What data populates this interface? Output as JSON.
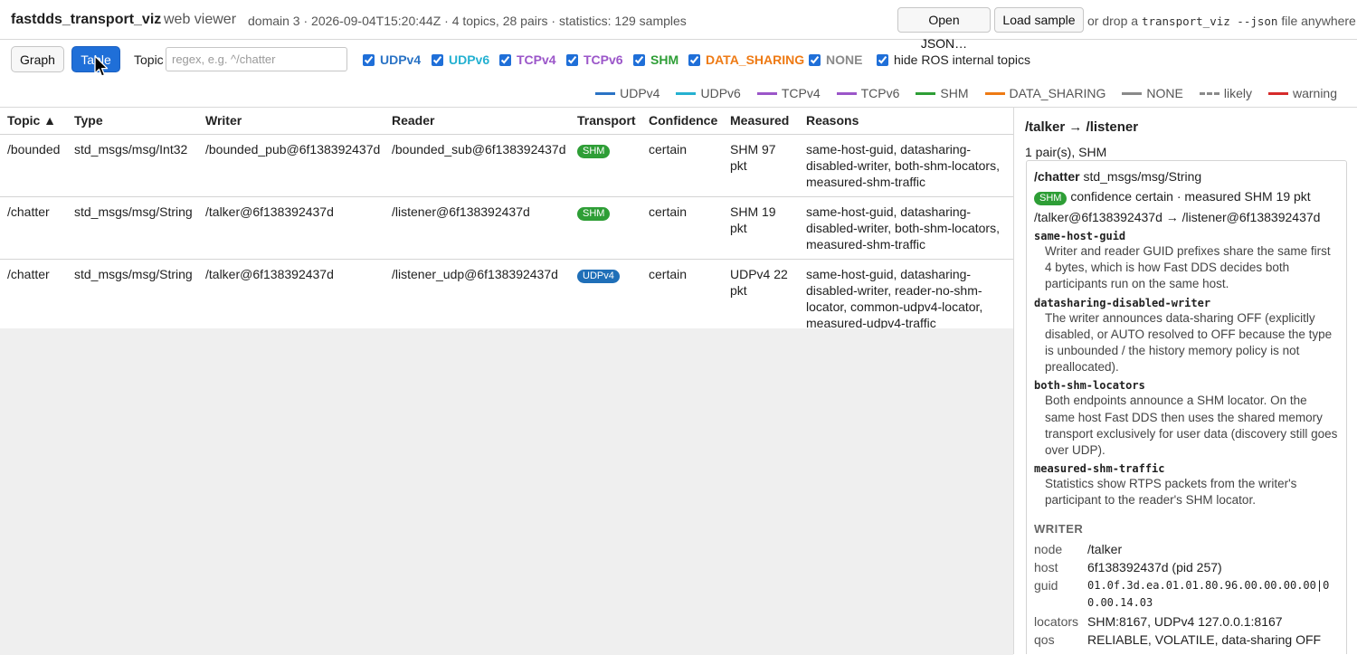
{
  "header": {
    "app_name": "fastdds_transport_viz",
    "subtitle": "web viewer",
    "summary": "domain 3 · 2026-09-04T15:20:44Z · 4 topics, 28 pairs · statistics: 129 samples",
    "open_json_label": "Open JSON…",
    "load_sample_label": "Load sample",
    "drop_hint_prefix": "or drop a",
    "drop_hint_code": "transport_viz --json",
    "drop_hint_suffix": "file anywhere"
  },
  "toolbar": {
    "graph_label": "Graph",
    "table_label": "Table",
    "active_view": "Table",
    "topic_label": "Topic",
    "topic_placeholder": "regex, e.g. ^/chatter",
    "topic_value": "",
    "transport_filters": [
      {
        "label": "UDPv4",
        "checked": true,
        "color": "#2a73c5"
      },
      {
        "label": "UDPv6",
        "checked": true,
        "color": "#25b1d1"
      },
      {
        "label": "TCPv4",
        "checked": true,
        "color": "#9b56c9"
      },
      {
        "label": "TCPv6",
        "checked": true,
        "color": "#9b56c9"
      },
      {
        "label": "SHM",
        "checked": true,
        "color": "#2e9e36"
      },
      {
        "label": "DATA_SHARING",
        "checked": true,
        "color": "#ee7a14"
      },
      {
        "label": "NONE",
        "checked": true,
        "color": "#8a8a8a"
      }
    ],
    "hide_ros_label": "hide ROS internal topics",
    "hide_ros_checked": true
  },
  "legend": [
    {
      "label": "UDPv4",
      "color": "#2a73c5",
      "style": "solid"
    },
    {
      "label": "UDPv6",
      "color": "#25b1d1",
      "style": "solid"
    },
    {
      "label": "TCPv4",
      "color": "#9b56c9",
      "style": "solid"
    },
    {
      "label": "TCPv6",
      "color": "#9b56c9",
      "style": "solid"
    },
    {
      "label": "SHM",
      "color": "#2e9e36",
      "style": "solid"
    },
    {
      "label": "DATA_SHARING",
      "color": "#ee7a14",
      "style": "solid"
    },
    {
      "label": "NONE",
      "color": "#8a8a8a",
      "style": "solid"
    },
    {
      "label": "likely",
      "color": "#8a8a8a",
      "style": "dashed"
    },
    {
      "label": "warning",
      "color": "#d62b2b",
      "style": "solid"
    }
  ],
  "table": {
    "columns": [
      "Topic ▲",
      "Type",
      "Writer",
      "Reader",
      "Transport",
      "Confidence",
      "Measured",
      "Reasons"
    ],
    "rows": [
      {
        "topic": "/bounded",
        "type": "std_msgs/msg/Int32",
        "writer": "/bounded_pub@6f138392437d",
        "reader": "/bounded_sub@6f138392437d",
        "transport": "SHM",
        "confidence": "certain",
        "measured": "SHM 97 pkt",
        "reasons": "same-host-guid, datasharing-disabled-writer, both-shm-locators, measured-shm-traffic"
      },
      {
        "topic": "/chatter",
        "type": "std_msgs/msg/String",
        "writer": "/talker@6f138392437d",
        "reader": "/listener@6f138392437d",
        "transport": "SHM",
        "confidence": "certain",
        "measured": "SHM 19 pkt",
        "reasons": "same-host-guid, datasharing-disabled-writer, both-shm-locators, measured-shm-traffic"
      },
      {
        "topic": "/chatter",
        "type": "std_msgs/msg/String",
        "writer": "/talker@6f138392437d",
        "reader": "/listener_udp@6f138392437d",
        "transport": "UDPv4",
        "confidence": "certain",
        "measured": "UDPv4 22 pkt",
        "reasons": "same-host-guid, datasharing-disabled-writer, reader-no-shm-locator, common-udpv4-locator, measured-udpv4-traffic"
      }
    ]
  },
  "detail": {
    "title": "/talker → /listener",
    "pair_count": "1 pair(s), SHM",
    "card": {
      "topic": "/chatter",
      "type": "std_msgs/msg/String",
      "transport": "SHM",
      "confidence_line": "confidence certain · measured SHM 19 pkt",
      "endpoints": "/talker@6f138392437d → /listener@6f138392437d",
      "reasons": [
        {
          "key": "same-host-guid",
          "text": "Writer and reader GUID prefixes share the same first 4 bytes, which is how Fast DDS decides both participants run on the same host."
        },
        {
          "key": "datasharing-disabled-writer",
          "text": "The writer announces data-sharing OFF (explicitly disabled, or AUTO resolved to OFF because the type is unbounded / the history memory policy is not preallocated)."
        },
        {
          "key": "both-shm-locators",
          "text": "Both endpoints announce a SHM locator. On the same host Fast DDS then uses the shared memory transport exclusively for user data (discovery still goes over UDP)."
        },
        {
          "key": "measured-shm-traffic",
          "text": "Statistics show RTPS packets from the writer's participant to the reader's SHM locator."
        }
      ],
      "writer_heading": "WRITER",
      "writer": [
        {
          "k": "node",
          "v": "/talker",
          "mono": false
        },
        {
          "k": "host",
          "v": "6f138392437d (pid 257)",
          "mono": false
        },
        {
          "k": "guid",
          "v": "01.0f.3d.ea.01.01.80.96.00.00.00.00|00.00.14.03",
          "mono": true
        },
        {
          "k": "locators",
          "v": "SHM:8167, UDPv4 127.0.0.1:8167",
          "mono": false
        },
        {
          "k": "qos",
          "v": "RELIABLE, VOLATILE, data-sharing OFF",
          "mono": false
        }
      ]
    }
  },
  "colors": {
    "accent": "#1f6fd8",
    "shm": "#2e9e36",
    "udpv4": "#2a73c5"
  }
}
